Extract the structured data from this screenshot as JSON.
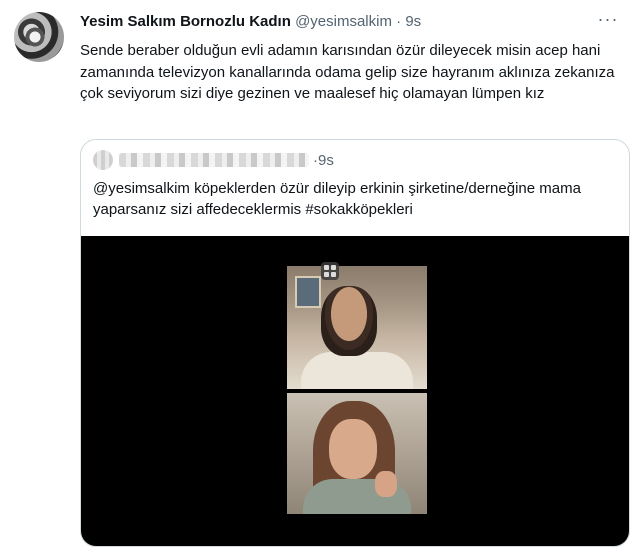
{
  "tweet": {
    "author_name": "Yesim Salkım Bornozlu Kadın",
    "handle": "@yesimsalkim",
    "separator": "·",
    "time": "9s",
    "more_label": "···",
    "text": "Sende beraber olduğun evli adamın karısından özür dileyecek misin acep hani zamanında televizyon kanallarında odama gelip size hayranım aklınıza zekanıza çok seviyorum sizi diye gezinen ve maalesef hiç olamayan lümpen kız"
  },
  "quoted_tweet": {
    "separator": "·",
    "time": "9s",
    "text": "@yesimsalkim köpeklerden özür dileyip  erkinin şirketine/derneğine mama yaparsanız sizi affedeceklermis #sokakköpekleri"
  },
  "icons": {
    "more": "more-icon",
    "video_layout": "grid-layout-icon"
  },
  "colors": {
    "text_primary": "#0f1419",
    "text_secondary": "#536471",
    "border": "#cfd9de",
    "video_bg": "#000000"
  }
}
